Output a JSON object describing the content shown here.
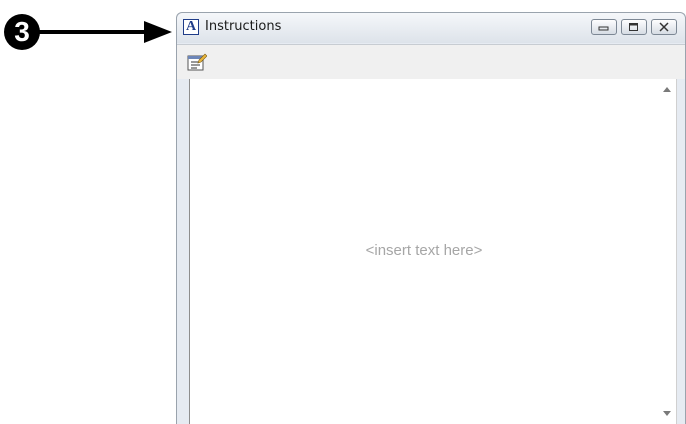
{
  "callout": {
    "number": "3"
  },
  "window": {
    "app_icon_letter": "A",
    "title": "Instructions",
    "controls": {
      "minimize": "minimize-icon",
      "maximize": "maximize-icon",
      "close": "close-icon"
    }
  },
  "toolbar": {
    "icon": "edit-properties-icon"
  },
  "content": {
    "placeholder": "<insert text here>"
  }
}
